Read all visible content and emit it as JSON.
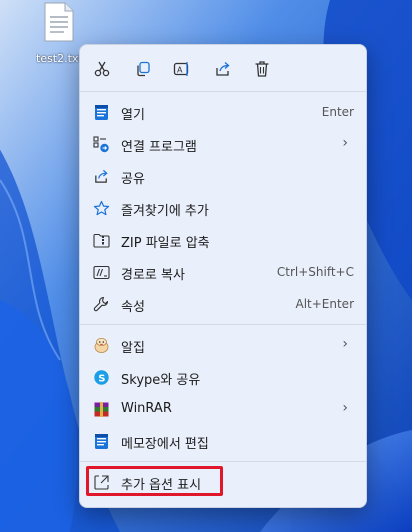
{
  "desktop": {
    "file_label": "test2.txt"
  },
  "toolbar": {
    "cut": "cut-icon",
    "copy": "copy-icon",
    "rename": "rename-icon",
    "share": "share-icon",
    "delete": "delete-icon"
  },
  "menu": {
    "items": [
      {
        "label": "열기",
        "shortcut": "Enter",
        "icon": "notepad-icon"
      },
      {
        "label": "연결 프로그램",
        "icon": "open-with-icon",
        "submenu": true
      },
      {
        "label": "공유",
        "icon": "share-icon"
      },
      {
        "label": "즐겨찾기에 추가",
        "icon": "star-icon"
      },
      {
        "label": "ZIP 파일로 압축",
        "icon": "zip-folder-icon"
      },
      {
        "label": "경로로 복사",
        "shortcut": "Ctrl+Shift+C",
        "icon": "copy-path-icon"
      },
      {
        "label": "속성",
        "shortcut": "Alt+Enter",
        "icon": "wrench-icon"
      },
      {
        "label": "알집",
        "icon": "alzip-icon",
        "submenu": true
      },
      {
        "label": "Skype와 공유",
        "icon": "skype-icon"
      },
      {
        "label": "WinRAR",
        "icon": "winrar-icon",
        "submenu": true
      },
      {
        "label": "메모장에서 편집",
        "icon": "notepad-icon"
      },
      {
        "label": "추가 옵션 표시",
        "icon": "more-options-icon"
      }
    ],
    "submenu_arrow": "›"
  },
  "colors": {
    "highlight": "#e0162b",
    "accent": "#1a73d9",
    "menu_bg": "#eaf0fb"
  }
}
